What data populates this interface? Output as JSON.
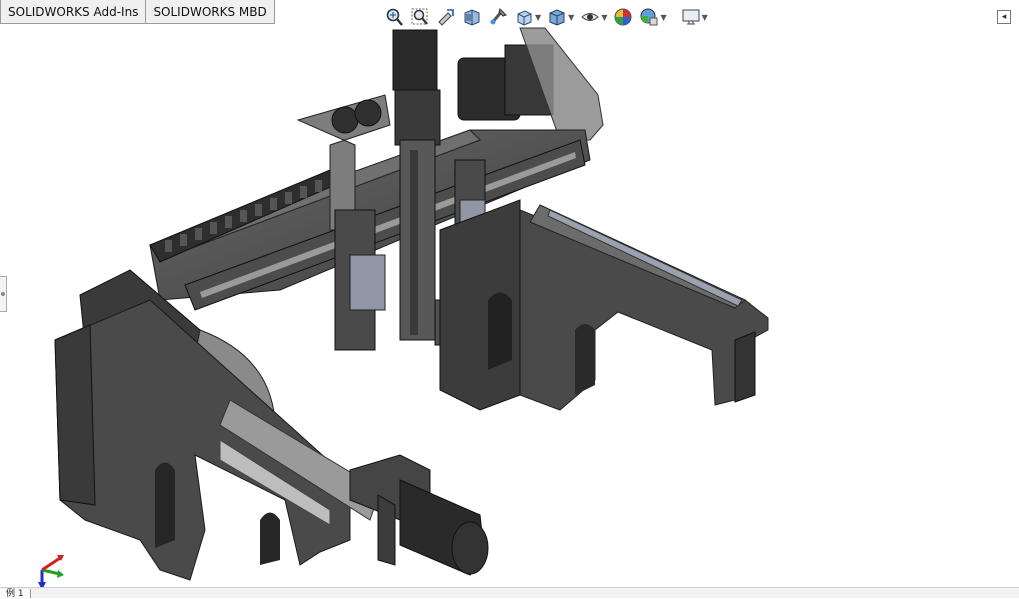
{
  "tabs": [
    {
      "label": "SOLIDWORKS Add-Ins"
    },
    {
      "label": "SOLIDWORKS MBD"
    }
  ],
  "heads_up_toolbar": {
    "icons": [
      "zoom-to-fit-icon",
      "zoom-to-area-icon",
      "previous-view-icon",
      "section-view-icon",
      "dynamic-annotation-icon",
      "view-orientation-icon",
      "display-style-icon",
      "hide-show-items-icon",
      "edit-appearance-icon",
      "apply-scene-icon",
      "view-settings-icon"
    ]
  },
  "status_bar": {
    "sheet_tab": "例 1"
  },
  "colors": {
    "background": "#ffffff",
    "model_dark": "#3a3a3a",
    "model_mid": "#5e5e5e",
    "model_light": "#8a8a8a",
    "rail": "#9aa2b0",
    "triad_x": "#d02020",
    "triad_y": "#20a020",
    "triad_z": "#2030c0"
  }
}
